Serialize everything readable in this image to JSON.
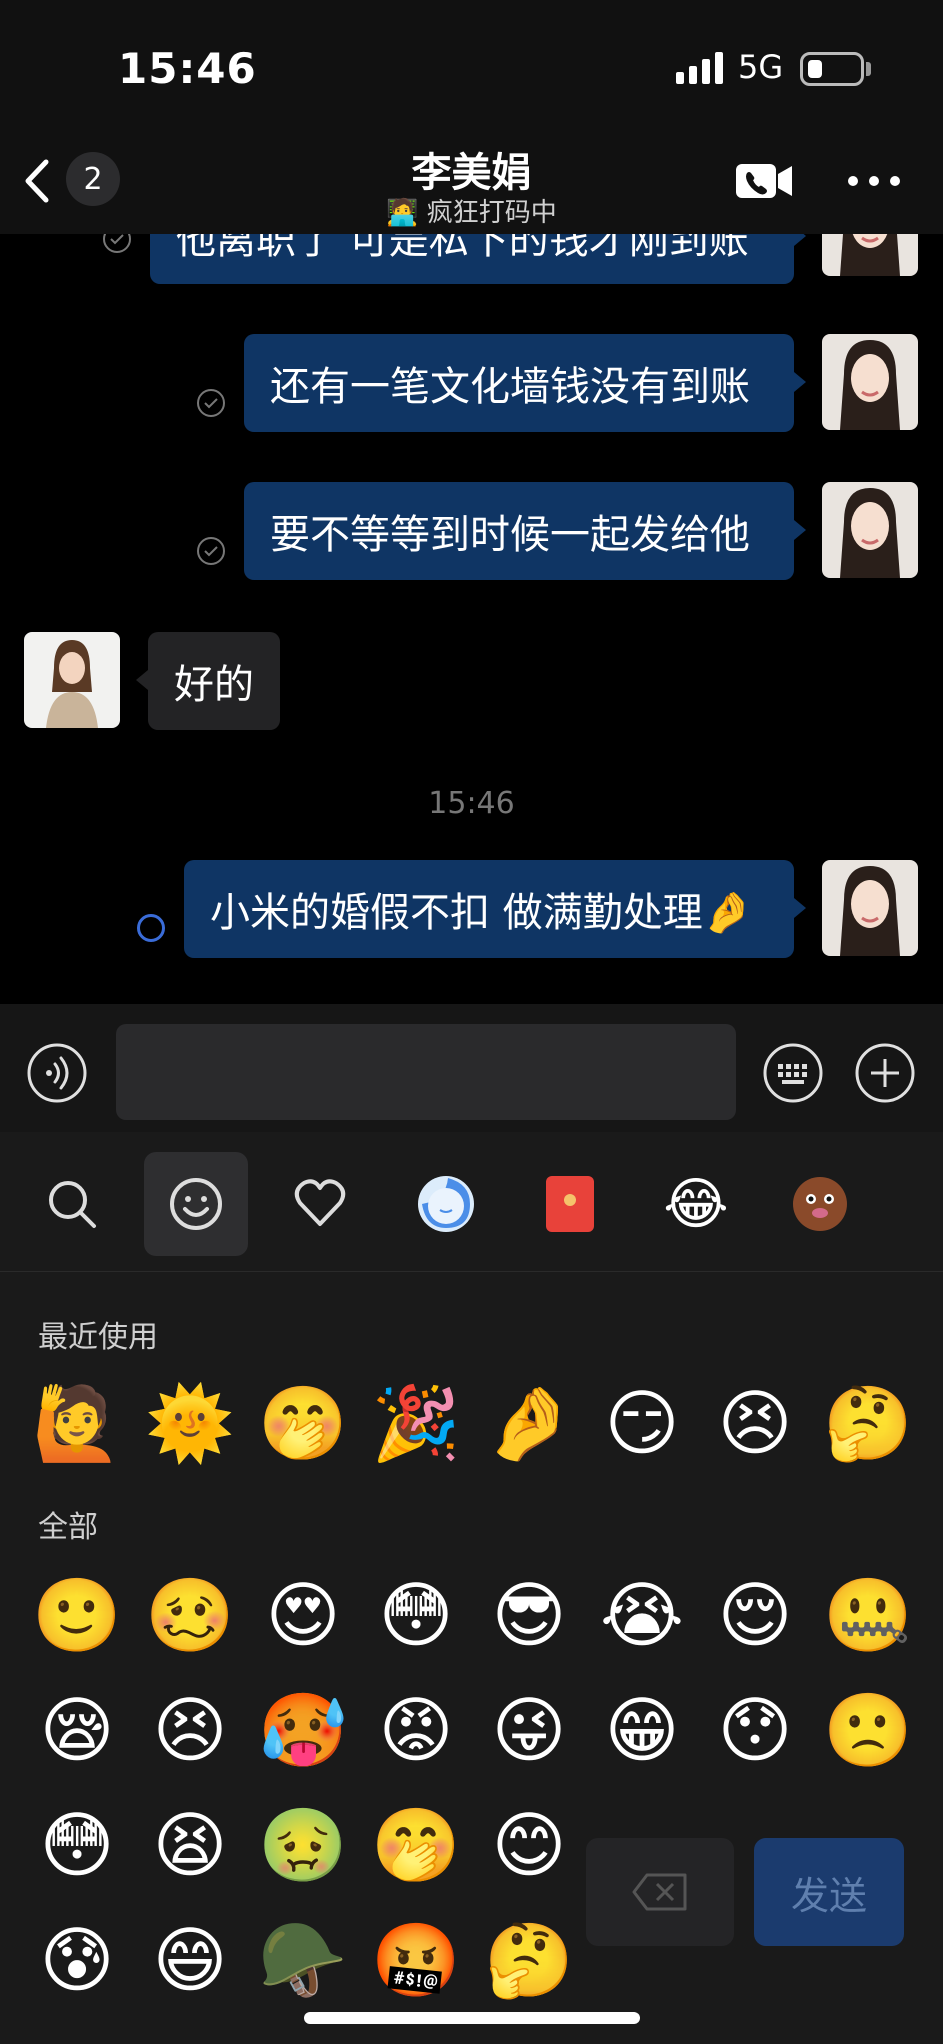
{
  "status_bar": {
    "time": "15:46",
    "network": "5G"
  },
  "header": {
    "back_count": "2",
    "contact_name": "李美娟",
    "contact_status": "🧑‍💻 疯狂打码中"
  },
  "chat": {
    "messages": [
      {
        "text": "他离职了 可是私下的钱才刚到账",
        "direction": "outgoing"
      },
      {
        "text": "还有一笔文化墙钱没有到账",
        "direction": "outgoing"
      },
      {
        "text": "要不等等到时候一起发给他",
        "direction": "outgoing"
      },
      {
        "text": "好的",
        "direction": "incoming"
      },
      {
        "text": "小米的婚假不扣 做满勤处理🤌",
        "direction": "outgoing"
      }
    ],
    "timestamp": "15:46"
  },
  "input": {
    "placeholder": ""
  },
  "emoji_panel": {
    "tabs": [
      "search-icon",
      "smile-icon",
      "heart-icon",
      "custom-sticker",
      "red-packet",
      "laugh-cry",
      "brown-face"
    ],
    "recent_label": "最近使用",
    "all_label": "全部",
    "recent": [
      "🙋",
      "🌞",
      "🤭",
      "🎉",
      "🤌",
      "😏",
      "😣",
      "🤔"
    ],
    "all": [
      "🙂",
      "🥴",
      "😍",
      "😳",
      "😎",
      "😭",
      "😌",
      "🤐",
      "😪",
      "😣",
      "🥵",
      "😡",
      "😜",
      "😁",
      "😯",
      "🙁",
      "😳",
      "😫",
      "🤢",
      "🤭",
      "😊",
      "😰",
      "😄",
      "🪖",
      "🤬",
      "🤔"
    ],
    "send_label": "发送"
  },
  "colors": {
    "outgoing_bubble": "#0f3564",
    "incoming_bubble": "#232325",
    "send_button": "#1b3b6e"
  }
}
